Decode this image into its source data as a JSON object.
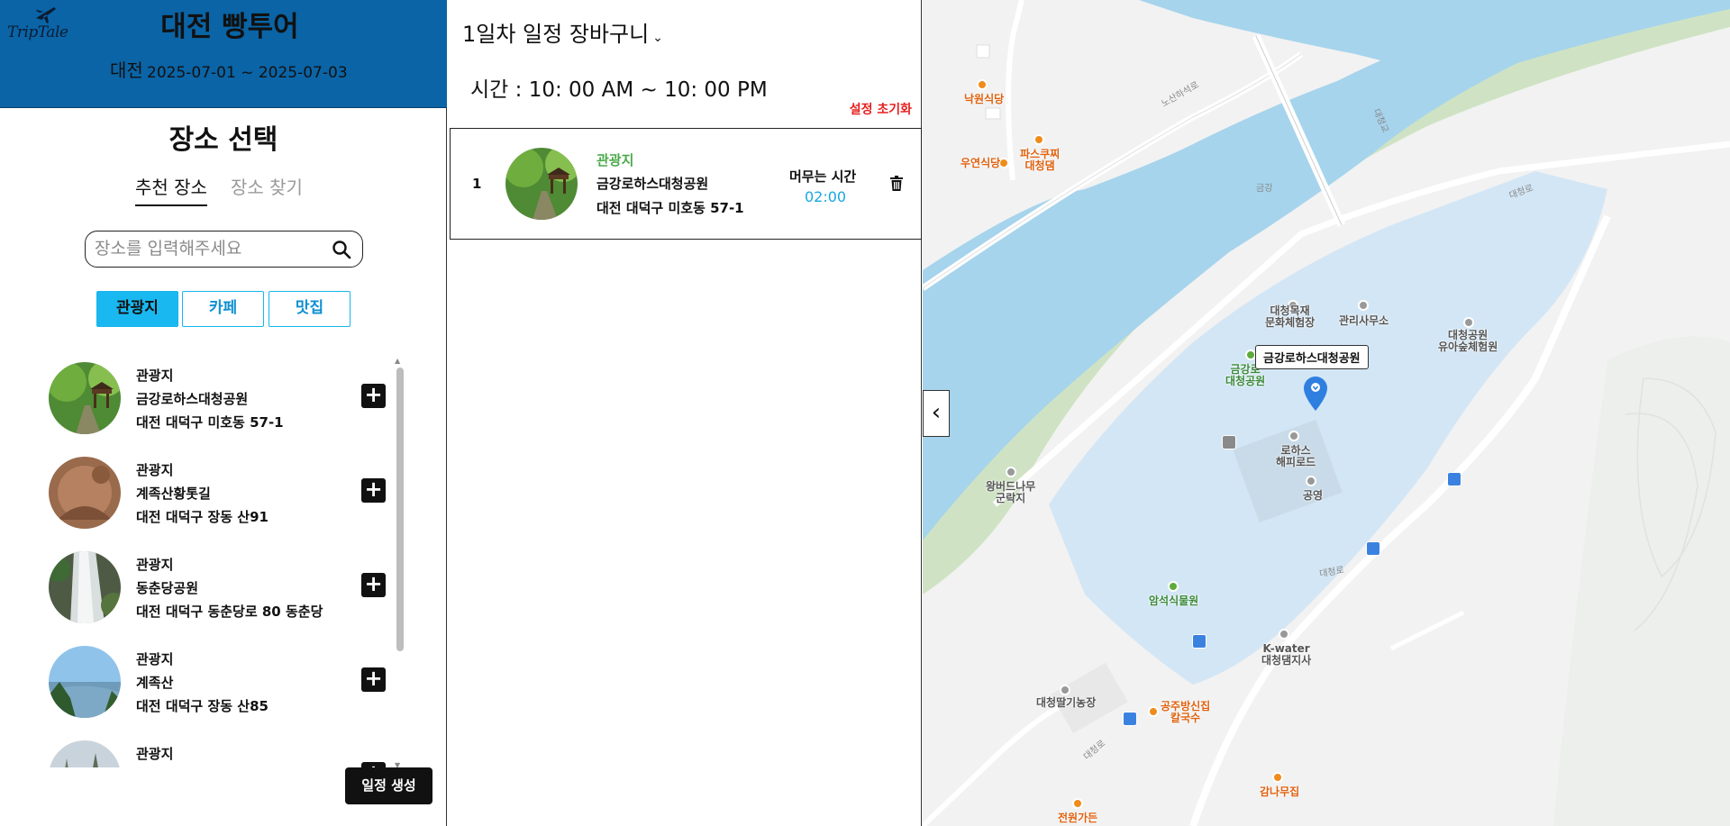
{
  "header": {
    "logo_text": "TripTale",
    "trip_title": "대전 빵투어",
    "city": "대전",
    "dates": "2025-07-01 ~ 2025-07-03"
  },
  "place_select": {
    "title": "장소 선택",
    "tabs": [
      {
        "label": "추천 장소",
        "active": true
      },
      {
        "label": "장소 찾기",
        "active": false
      }
    ],
    "search_placeholder": "장소를 입력해주세요",
    "categories": [
      {
        "label": "관광지",
        "active": true
      },
      {
        "label": "카페",
        "active": false
      },
      {
        "label": "맛집",
        "active": false
      }
    ],
    "items": [
      {
        "category": "관광지",
        "name": "금강로하스대청공원",
        "address": "대전 대덕구 미호동 57-1",
        "icon": "park-pavilion-photo"
      },
      {
        "category": "관광지",
        "name": "계족산황톳길",
        "address": "대전 대덕구 장동 산91",
        "icon": "red-clay-path-photo"
      },
      {
        "category": "관광지",
        "name": "동춘당공원",
        "address": "대전 대덕구 동춘당로 80 동춘당",
        "icon": "waterfall-photo"
      },
      {
        "category": "관광지",
        "name": "계족산",
        "address": "대전 대덕구 장동 산85",
        "icon": "mountain-view-photo"
      },
      {
        "category": "관광지",
        "name": "",
        "address": "",
        "icon": "forest-photo"
      }
    ],
    "add_symbol": "+",
    "generate_button": "일정 생성"
  },
  "schedule": {
    "day_selector": "1일차 일정 장바구니",
    "time_range": "시간 : 10: 00 AM ~ 10: 00 PM",
    "reset_label": "설정 초기화",
    "entries": [
      {
        "index": "1",
        "category": "관광지",
        "name": "금강로하스대청공원",
        "address": "대전 대덕구 미호동 57-1",
        "stay_label": "머무는 시간",
        "stay_time": "02:00"
      }
    ]
  },
  "map": {
    "selected_place": "금강로하스대청공원",
    "labels": {
      "nakwon": "낙원식당",
      "woyeon": "우연식당",
      "pasta": "파스쿠찌\n대청댐",
      "noksan": "노산하석로",
      "daecheong_bridge": "대청교",
      "geumgang": "금강",
      "daecheong_ro1": "대청로",
      "daecheong_ro2": "대청로",
      "daecheong_ro3": "대청로",
      "mokjae": "대청목재\n문화체험장",
      "office": "관리사무소",
      "forest_exp": "대청공원\n유아숲체험원",
      "park_green": "금강로\n대청공원",
      "lohas_road": "로하스\n해피로드",
      "parking": "공영",
      "wangbeodeu": "왕버드나무\n군락지",
      "amseok": "암석식물원",
      "kwater": "K-water\n대청댐지사",
      "farm": "대청딸기농장",
      "gongju": "공주방신집\n칼국수",
      "gamnamu": "감나무집",
      "jeonwon": "전원가든"
    },
    "colors": {
      "river": "#a6d4ec",
      "park": "#d3e6f5",
      "green": "#cfe3c4",
      "pin": "#2f7fe0"
    }
  }
}
